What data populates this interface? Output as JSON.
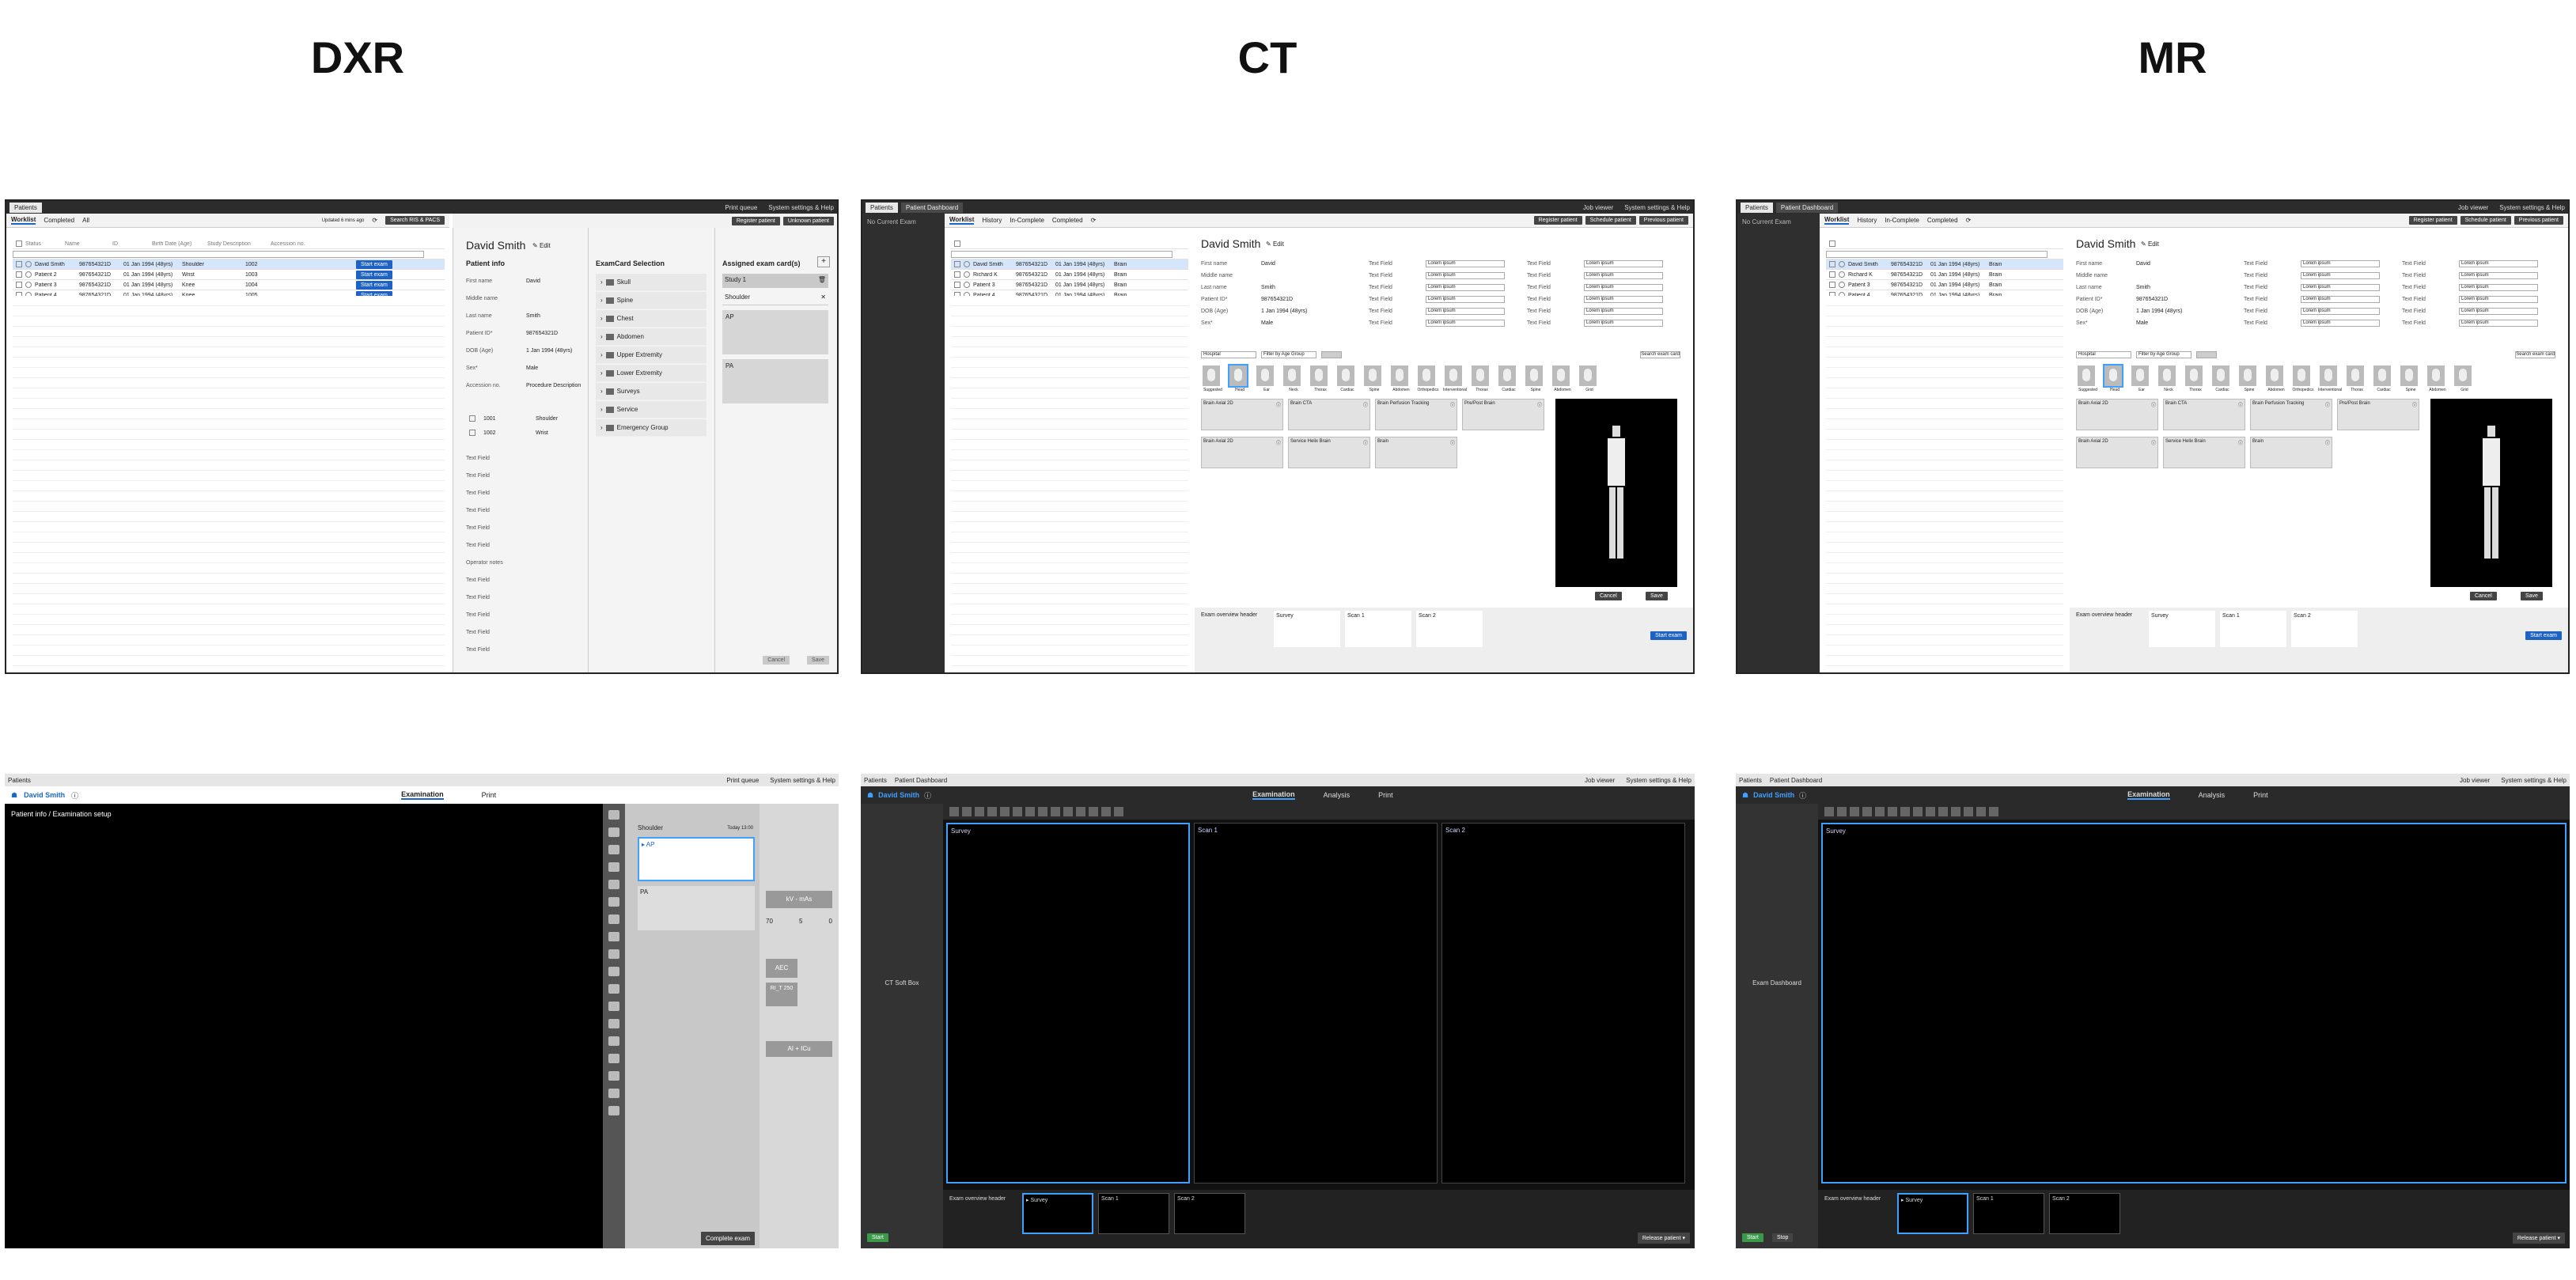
{
  "headers": [
    "DXR",
    "CT",
    "MR"
  ],
  "common": {
    "patients_tab": "Patients",
    "patient_dashboard_tab": "Patient Dashboard",
    "job_viewer": "Job viewer",
    "settings": "System settings & Help",
    "print_queue": "Print queue",
    "no_current_exam": "No Current Exam",
    "patient_name": "David Smith",
    "edit": "Edit"
  },
  "dxr_worklist": {
    "tabs": [
      "Worklist",
      "Completed",
      "All"
    ],
    "updated": "Updated 6 mins ago",
    "search_btn": "Search RIS & PACS",
    "register_btn": "Register patient",
    "unknown_btn": "Unknown patient",
    "columns": [
      "Status",
      "Name",
      "ID",
      "Birth Date (Age)",
      "Study Description",
      "Accession no."
    ],
    "rows": [
      {
        "name": "David Smith",
        "id": "987654321D",
        "dob": "01 Jan 1994 (48yrs)",
        "desc": "Shoulder",
        "acc": "1002"
      },
      {
        "name": "Patient 2",
        "id": "987654321D",
        "dob": "01 Jan 1994 (48yrs)",
        "desc": "Wrist",
        "acc": "1003"
      },
      {
        "name": "Patient 3",
        "id": "987654321D",
        "dob": "01 Jan 1994 (48yrs)",
        "desc": "Knee",
        "acc": "1004"
      },
      {
        "name": "Patient 4",
        "id": "987654321D",
        "dob": "01 Jan 1994 (48yrs)",
        "desc": "Knee",
        "acc": "1005"
      },
      {
        "name": "Patient 5",
        "id": "987654321D",
        "dob": "01 Jan 1994 (48yrs)",
        "desc": "Knee",
        "acc": "1006"
      }
    ],
    "start_exam": "Start exam",
    "patient_info": "Patient info",
    "fields": [
      {
        "label": "First name",
        "value": "David"
      },
      {
        "label": "Middle name",
        "value": ""
      },
      {
        "label": "Last name",
        "value": "Smith"
      },
      {
        "label": "Patient ID*",
        "value": "987654321D"
      },
      {
        "label": "DOB (Age)",
        "value": "1 Jan 1994 (48yrs)"
      },
      {
        "label": "Sex*",
        "value": "Male"
      },
      {
        "label": "Accession no.",
        "value": "Procedure Description"
      }
    ],
    "procedures": [
      {
        "code": "1001",
        "name": "Shoulder"
      },
      {
        "code": "1002",
        "name": "Wrist"
      }
    ],
    "text_field": "Text Field",
    "operator_notes": "Operator notes",
    "examcard_title": "ExamCard Selection",
    "categories": [
      "Skull",
      "Spine",
      "Chest",
      "Abdomen",
      "Upper Extremity",
      "Lower Extremity",
      "Surveys",
      "Service",
      "Emergency Group"
    ],
    "assigned_title": "Assigned exam card(s)",
    "study": "Study 1",
    "shoulder": "Shoulder",
    "views": [
      "AP",
      "PA"
    ],
    "cancel": "Cancel",
    "save": "Save"
  },
  "ct_worklist": {
    "tabs": [
      "Worklist",
      "History",
      "In-Complete",
      "Completed"
    ],
    "register_btn": "Register patient",
    "schedule_btn": "Schedule patient",
    "previous_btn": "Previous patient",
    "rows": [
      {
        "name": "David Smith",
        "id": "987654321D",
        "dob": "01 Jan 1994 (48yrs)",
        "desc": "Brain"
      },
      {
        "name": "Richard K",
        "id": "987654321D",
        "dob": "01 Jan 1994 (48yrs)",
        "desc": "Brain"
      },
      {
        "name": "Patient 3",
        "id": "987654321D",
        "dob": "01 Jan 1994 (48yrs)",
        "desc": "Brain"
      },
      {
        "name": "Patient 4",
        "id": "987654321D",
        "dob": "01 Jan 1994 (48yrs)",
        "desc": "Brain"
      },
      {
        "name": "Patient 5",
        "id": "987654321D",
        "dob": "01 Jan 1994 (48yrs)",
        "desc": "Brain"
      }
    ],
    "fields": [
      {
        "label": "First name",
        "value": "David"
      },
      {
        "label": "Middle name",
        "value": ""
      },
      {
        "label": "Last name",
        "value": "Smith"
      },
      {
        "label": "Patient ID*",
        "value": "987654321D"
      },
      {
        "label": "DOB (Age)",
        "value": "1 Jan 1994 (48yrs)"
      },
      {
        "label": "Sex*",
        "value": "Male"
      }
    ],
    "lorem": "Lorem ipsum",
    "hospital": "Hospital",
    "filter": "Filter by Age Group",
    "search_exam": "Search exam card",
    "anatomy": [
      "Suggested",
      "Head",
      "Ear",
      "Neck",
      "Thorax",
      "Cardiac",
      "Spine",
      "Abdomen",
      "Orthopedics",
      "Interventional",
      "Thorax",
      "Cardiac",
      "Spine",
      "Abdomen",
      "Grid"
    ],
    "cards": [
      "Brain Axial 2D",
      "Brain CTA",
      "Brain Perfusion Tracking",
      "Pre/Post Brain",
      "Brain Axial 2D",
      "Service Helix Brain",
      "Brain"
    ],
    "cancel": "Cancel",
    "save": "Save",
    "overview_header": "Exam overview header",
    "scans": [
      "Survey",
      "Scan 1",
      "Scan 2"
    ],
    "start_exam": "Start exam"
  },
  "dxr_exam": {
    "tabs": [
      "Examination",
      "Print"
    ],
    "setup": "Patient info / Examination setup",
    "shoulder": "Shoulder",
    "today": "Today 13:00",
    "views": [
      "AP",
      "PA"
    ],
    "complete": "Complete exam",
    "kv": "kV - mAs",
    "values": [
      "70",
      "5",
      "0"
    ],
    "aec": "AEC",
    "rt": "RI_T 250",
    "aic": "AI + ICu"
  },
  "ct_exam": {
    "tabs": [
      "Examination",
      "Analysis",
      "Print"
    ],
    "side_label": "CT Soft Box",
    "scans": [
      "Survey",
      "Scan 1",
      "Scan 2"
    ],
    "overview_header": "Exam overview header",
    "start": "Start",
    "release": "Release patient"
  },
  "mr_exam": {
    "tabs": [
      "Examination",
      "Analysis",
      "Print"
    ],
    "side_label": "Exam Dashboard",
    "scans": [
      "Survey",
      "Scan 1",
      "Scan 2"
    ],
    "overview_header": "Exam overview header",
    "start": "Start",
    "stop": "Stop",
    "release": "Release patient"
  }
}
